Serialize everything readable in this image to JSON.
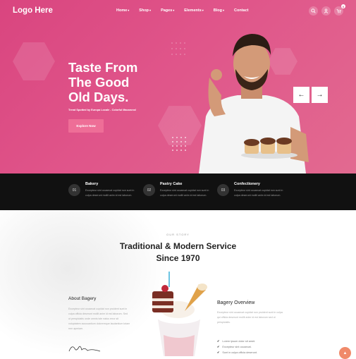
{
  "brand": {
    "logo": "Logo Here"
  },
  "nav": {
    "items": [
      {
        "label": "Home",
        "dropdown": true
      },
      {
        "label": "Shop",
        "dropdown": true
      },
      {
        "label": "Pages",
        "dropdown": true
      },
      {
        "label": "Elements",
        "dropdown": true
      },
      {
        "label": "Blog",
        "dropdown": true
      },
      {
        "label": "Contact",
        "dropdown": false
      }
    ]
  },
  "header_icons": {
    "search": "search-icon",
    "account": "user-icon",
    "cart": "cart-icon",
    "cart_count": "0"
  },
  "hero": {
    "title_lines": [
      "Taste From",
      "The Good",
      "Old Days."
    ],
    "subtitle": "Trend Spotted by Europa Locale - Colorful Macarons!",
    "cta": "Explore Now",
    "prev": "←",
    "next": "→"
  },
  "features": [
    {
      "num": "01",
      "title": "Bakery",
      "desc": "Excepteur sint occaecat cupidat non sunt in culpa deserunt mollit anim id est laborum."
    },
    {
      "num": "02",
      "title": "Pastry Cake",
      "desc": "Excepteur sint occaecat cupidat non sunt in culpa deserunt mollit anim id est laborum."
    },
    {
      "num": "03",
      "title": "Confectionery",
      "desc": "Excepteur sint occaecat cupidat non sunt in culpa deserunt mollit anim id est laborum."
    }
  ],
  "story": {
    "eyebrow": "OUR STORY",
    "title_line1": "Traditional & Modern Service",
    "title_line2": "Since 1970",
    "about_title": "About Bagery",
    "about_text": "Excepteur sint occaecat cupidat non proident sunt in culpa officia deserunt mollit anim id est laborum. Sed ut perspiciatis unde omnis iste natus error sit voluptatem accusantium doloremque laudantium totam rem aperiam.",
    "overview_title": "Bagery Overview",
    "overview_text": "Excepteur sint occaecat cupidat non proident sunt in culpa qui officia deserunt mollit anim id est laborum sed ut perspiciatis.",
    "overview_list": [
      "Lorem ipsum dolor sit amet.",
      "Excepteur sint occaecat.",
      "Sunt in culpa officia deserunt."
    ]
  },
  "colors": {
    "brand": "#d9457f",
    "dark": "#111111",
    "accent": "#f08a6a"
  }
}
